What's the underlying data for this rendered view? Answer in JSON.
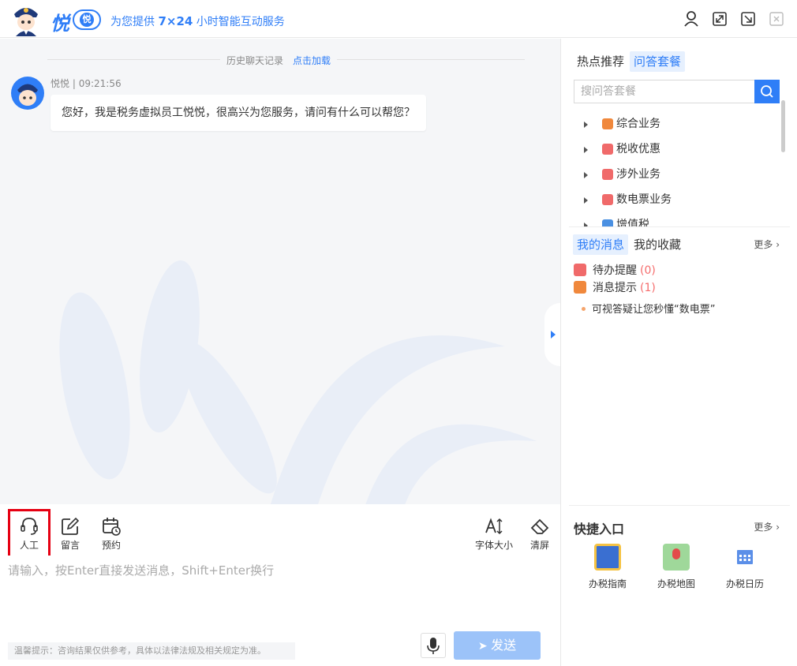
{
  "header": {
    "brand": "悦",
    "badge": "悦",
    "slogan_pre": "为您提供",
    "slogan_bold": "7×24",
    "slogan_post": "小时智能互动服务",
    "icons": [
      "user-icon",
      "fullscreen-icon",
      "minimize-window-icon",
      "close-icon"
    ]
  },
  "chat": {
    "history_label": "历史聊天记录",
    "history_link": "点击加载",
    "messages": [
      {
        "sender": "悦悦",
        "time": "09:21:56",
        "text": "您好，我是税务虚拟员工悦悦，很高兴为您服务，请问有什么可以帮您？"
      }
    ]
  },
  "toolbar": {
    "human": "人工",
    "message": "留言",
    "appointment": "预约",
    "font_size": "字体大小",
    "clear": "清屏"
  },
  "composer": {
    "placeholder": "请输入，按Enter直接发送消息，Shift+Enter换行",
    "value": "",
    "tip": "温馨提示：咨询结果仅供参考，具体以法律法规及相关规定为准。",
    "send": "发送"
  },
  "right": {
    "tabs": [
      "热点推荐",
      "问答套餐"
    ],
    "active_tab": "问答套餐",
    "search_placeholder": "搜问答套餐",
    "tree": [
      {
        "label": "综合业务",
        "color": "#f0883c"
      },
      {
        "label": "税收优惠",
        "color": "#f06a6a"
      },
      {
        "label": "涉外业务",
        "color": "#f06a6a"
      },
      {
        "label": "数电票业务",
        "color": "#f06a6a"
      },
      {
        "label": "增值税",
        "color": "#4a90e2"
      }
    ],
    "msg_tabs": [
      "我的消息",
      "我的收藏"
    ],
    "more": "更多",
    "todo_label": "待办提醒",
    "todo_count": "(0)",
    "notice_label": "消息提示",
    "notice_count": "(1)",
    "notice_item": "可视答疑让您秒懂“数电票”",
    "quick_title": "快捷入口",
    "quick_more": "更多",
    "quick": [
      {
        "label": "办税指南",
        "icon": "tax-guide-icon"
      },
      {
        "label": "办税地图",
        "icon": "tax-map-icon"
      },
      {
        "label": "办税日历",
        "icon": "tax-calendar-icon"
      }
    ]
  },
  "colors": {
    "brand": "#2f7ef7",
    "highlight_box": "#e60012",
    "send_disabled": "#9cc3f9"
  }
}
